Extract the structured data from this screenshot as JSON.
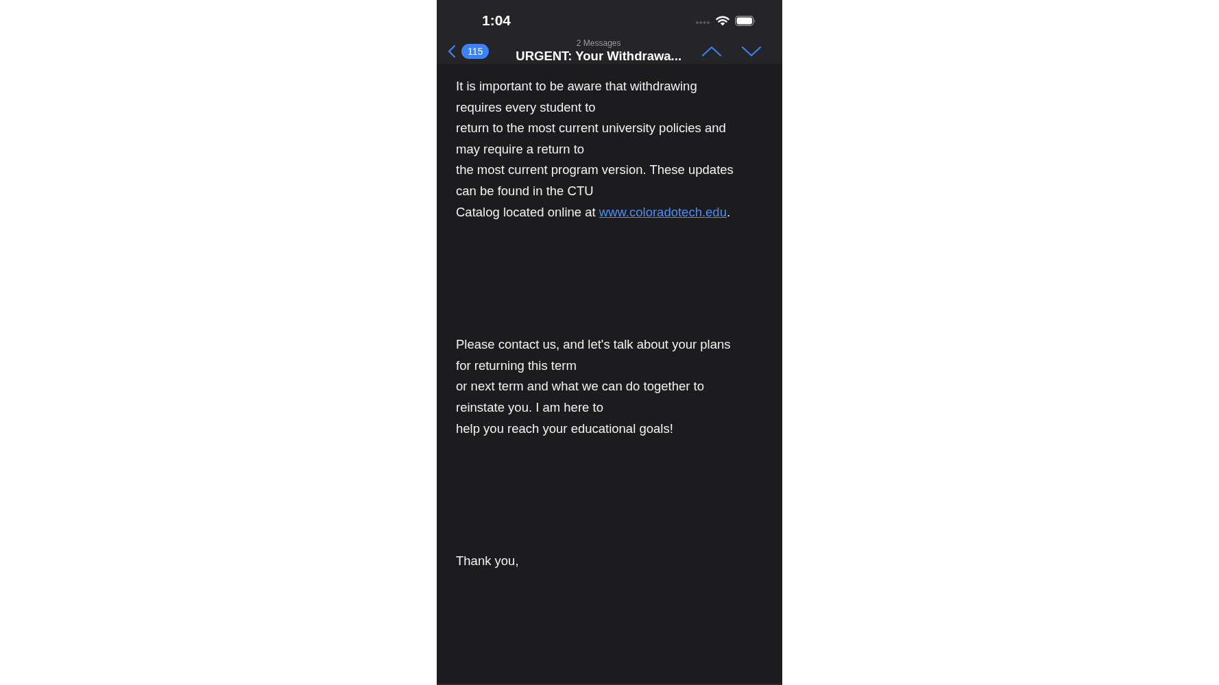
{
  "status_bar": {
    "time": "1:04"
  },
  "nav": {
    "unread_count": "115",
    "subtitle": "2 Messages",
    "title": "URGENT: Your Withdrawa..."
  },
  "body": {
    "paragraphs": [
      {
        "lines": [
          {
            "text": "It is important to be aware that withdrawing"
          },
          {
            "text": "requires every student to"
          },
          {
            "text": "return to the most current university policies and"
          },
          {
            "text": "may require a return to"
          },
          {
            "text": "the most current program version. These updates"
          },
          {
            "text": "can be found in the CTU"
          },
          {
            "text": "Catalog located online at ",
            "link": "www.coloradotech.edu",
            "after": "."
          }
        ]
      },
      {
        "lines": [
          {
            "text": "Please contact us, and let's talk about your plans"
          },
          {
            "text": "for returning this term"
          },
          {
            "text": "or next term and what we can do together to"
          },
          {
            "text": "reinstate you. I am here to"
          },
          {
            "text": "help you reach your educational goals!"
          }
        ]
      },
      {
        "lines": [
          {
            "text": "Thank you,"
          }
        ]
      }
    ]
  }
}
